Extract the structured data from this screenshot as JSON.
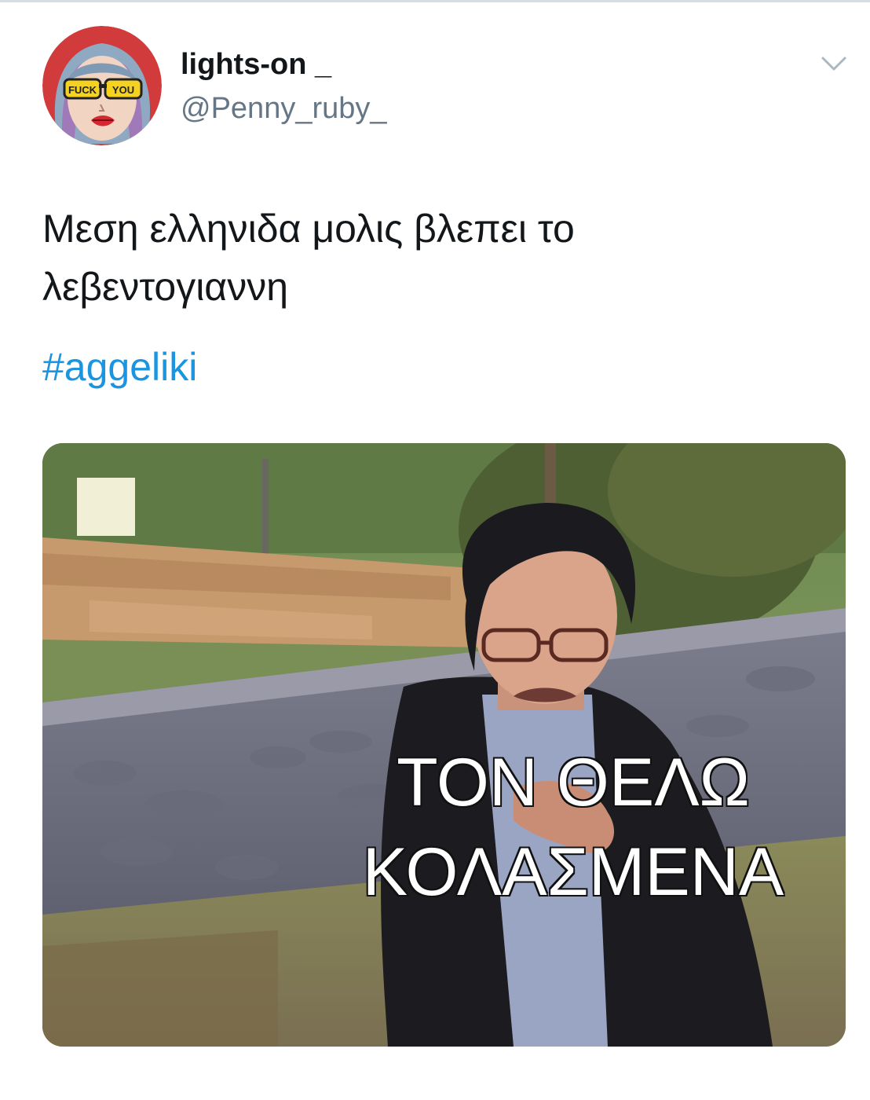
{
  "tweet": {
    "author": {
      "display_name": "lights-on _",
      "handle": "@Penny_ruby_",
      "avatar_text": [
        "FUCK",
        "YOU"
      ]
    },
    "text_lines": [
      "Μεση ελληνιδα μολις βλεπει το",
      "λεβεντογιαννη"
    ],
    "hashtag": "#aggeliki",
    "media": {
      "caption_lines": [
        "ΤΟΝ ΘΕΛΩ",
        "ΚΟΛΑΣΜΕΝΑ"
      ]
    }
  },
  "icons": {
    "menu": "chevron-down-icon"
  },
  "colors": {
    "text_primary": "#14171a",
    "text_secondary": "#657786",
    "link": "#1b95e0"
  }
}
